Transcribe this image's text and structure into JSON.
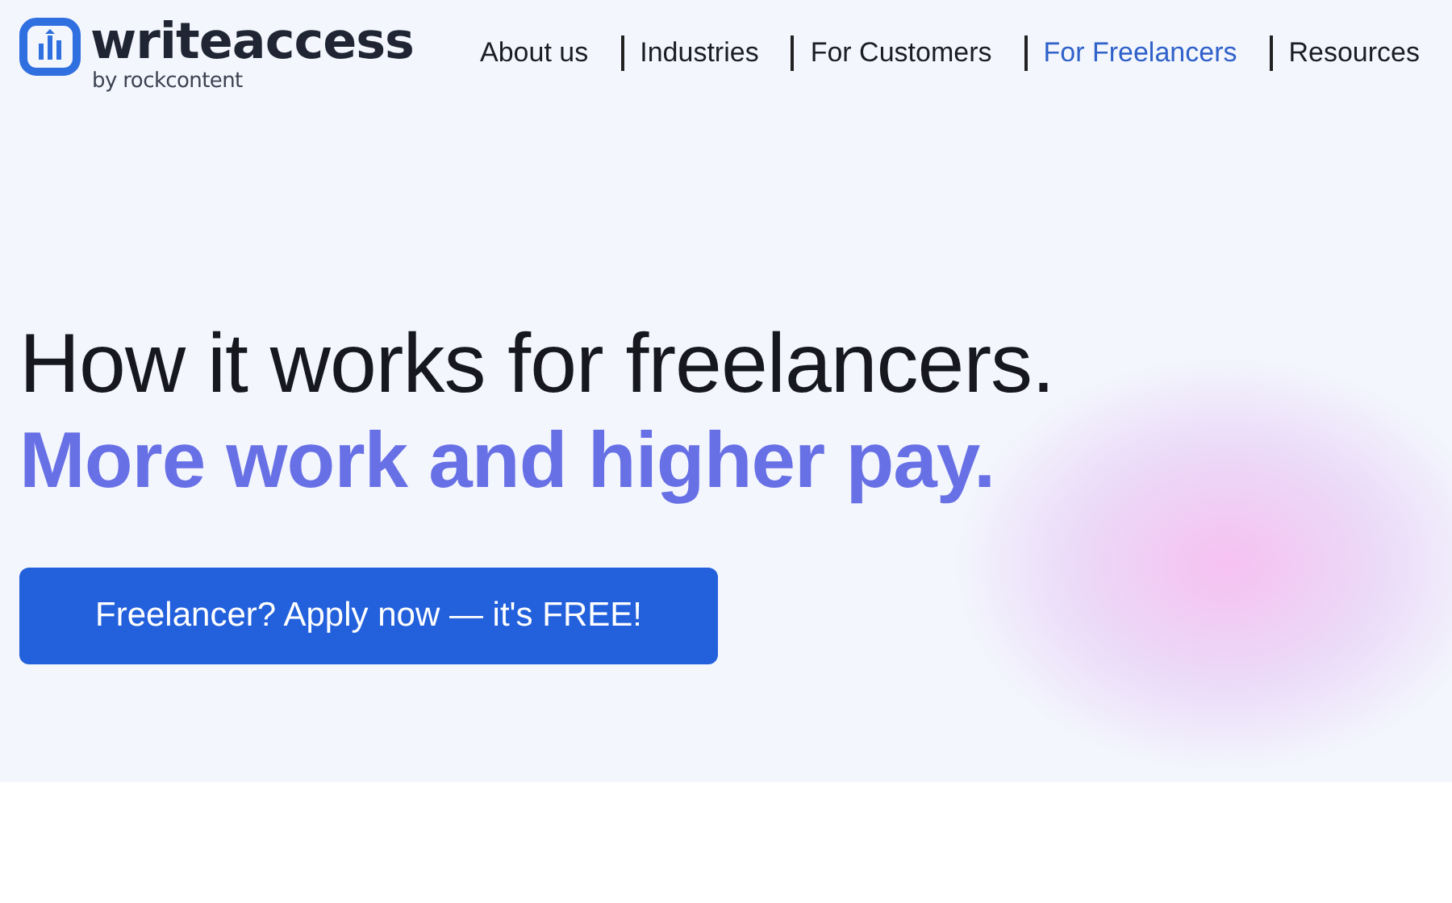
{
  "logo": {
    "name": "writeaccess",
    "byline": "by rockcontent"
  },
  "nav": [
    {
      "label": "About us",
      "selected": false
    },
    {
      "label": "Industries",
      "selected": false
    },
    {
      "label": "For Customers",
      "selected": false
    },
    {
      "label": "For Freelancers",
      "selected": true
    },
    {
      "label": "Resources",
      "selected": false
    }
  ],
  "hero": {
    "title": "How it works for freelancers.",
    "subtitle": "More work and higher pay.",
    "button": "Freelancer? Apply now — it's FREE!"
  }
}
